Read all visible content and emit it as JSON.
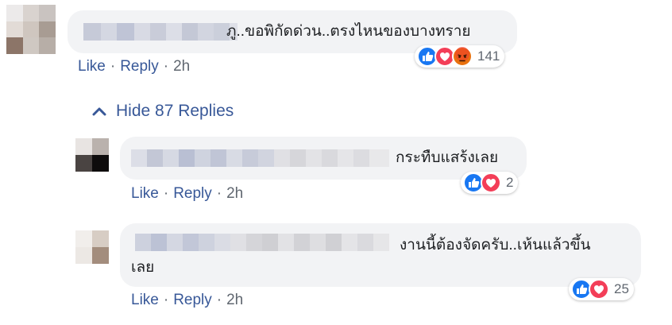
{
  "comments": [
    {
      "text": "ภู..ขอพิกัดด่วน..ตรงไหนของบางทราย",
      "reaction_count": "141",
      "reaction_icons": [
        "like-icon",
        "love-icon",
        "angry-icon"
      ]
    }
  ],
  "hide_replies_label": "Hide 87 Replies",
  "replies": [
    {
      "text": "กระทืบแสร้งเลย",
      "reaction_count": "2",
      "reaction_icons": [
        "like-icon",
        "love-icon"
      ]
    },
    {
      "text_line1": "งานนี้ต้องจัดครับ..เห้นแล้วขึ้น",
      "text_line2": "เลย",
      "reaction_count": "25",
      "reaction_icons": [
        "like-icon",
        "love-icon"
      ]
    }
  ],
  "actions": {
    "like": "Like",
    "reply": "Reply",
    "separator": "·",
    "time": "2h"
  },
  "colors": {
    "link": "#385898",
    "bubble": "#f2f3f5",
    "like_blue": "#1877f2",
    "love_red": "#f33e58",
    "angry_orange": "#e9710f"
  }
}
